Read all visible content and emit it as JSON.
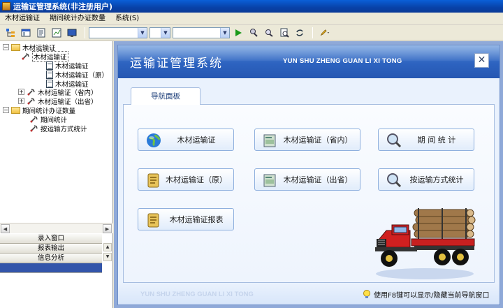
{
  "window": {
    "title": "运输证管理系统(非注册用户)"
  },
  "menu": [
    {
      "label": "木材运输证"
    },
    {
      "label": "期间统计办证数量"
    },
    {
      "label": "系统(S)"
    }
  ],
  "toolbar": {
    "combo1": "",
    "combo2": "",
    "combo3": ""
  },
  "tree": {
    "root1": "木材运输证",
    "child1": "木材运输证",
    "leaf1": "木材运输证",
    "leaf2": "木材运输证（原）",
    "leaf3": "木材运输证",
    "child2": "木材运输证（省内）",
    "child3": "木材运输证（出省）",
    "root2": "期间统计办证数量",
    "child4": "期间统计",
    "child5": "按运输方式统计"
  },
  "left_tabs": [
    {
      "label": "录入窗口"
    },
    {
      "label": "报表输出"
    },
    {
      "label": "信息分析"
    },
    {
      "label": ""
    }
  ],
  "panel": {
    "title": "运输证管理系统",
    "subtitle": "YUN SHU ZHENG GUAN LI XI TONG",
    "close": "✕",
    "tab": "导航面板",
    "footer_subtitle": "YUN SHU ZHENG GUAN LI XI TONG",
    "footer_hint": "使用F8键可以显示/隐藏当前导航窗口"
  },
  "nav_buttons": [
    {
      "label": "木材运输证",
      "icon": "globe-icon"
    },
    {
      "label": "木材运输证（省内）",
      "icon": "certificate-icon"
    },
    {
      "label": "期 间 统 计",
      "icon": "magnifier-icon"
    },
    {
      "label": "木材运输证（原）",
      "icon": "notepad-icon"
    },
    {
      "label": "木材运输证（出省）",
      "icon": "certificate-icon"
    },
    {
      "label": "按运输方式统计",
      "icon": "magnifier-icon"
    },
    {
      "label": "木材运输证报表",
      "icon": "notepad-icon"
    }
  ],
  "colors": {
    "header": "#2d63c0",
    "accent": "#3355aa",
    "truck": "#d02020"
  }
}
